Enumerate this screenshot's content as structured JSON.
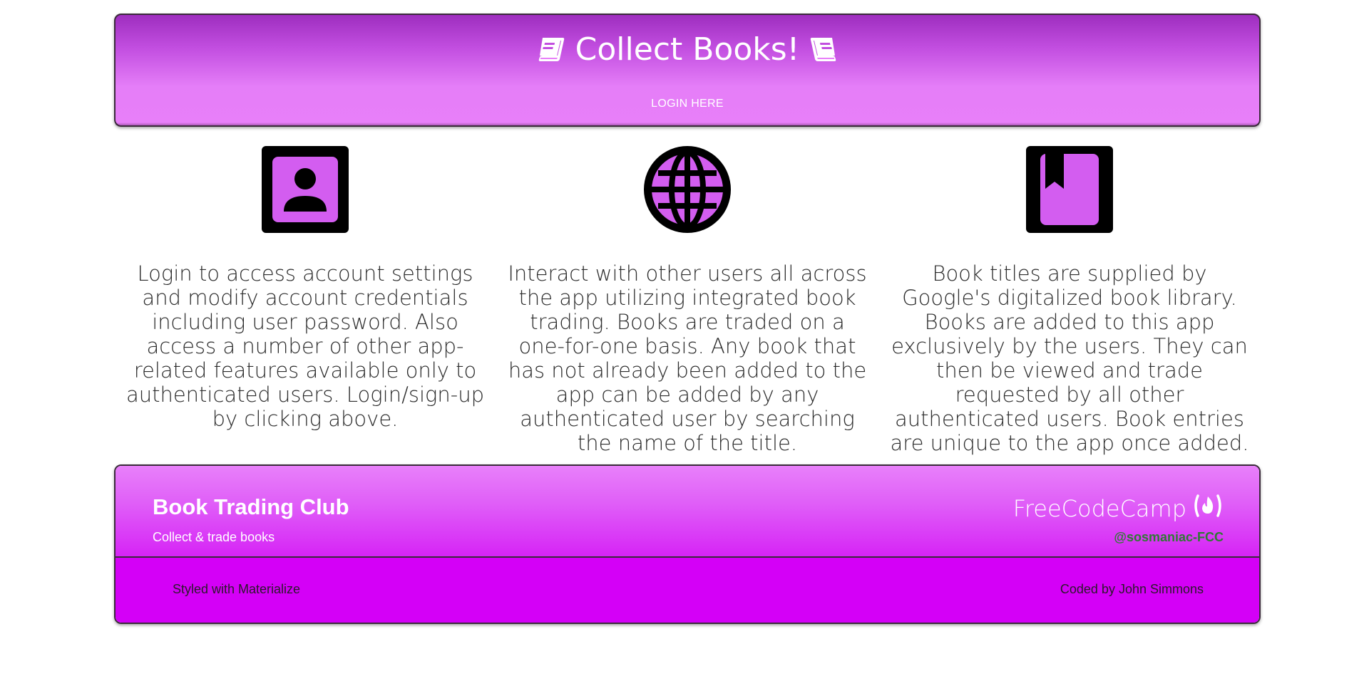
{
  "header": {
    "title": "Collect Books!",
    "login_label": "LOGIN HERE"
  },
  "features": [
    {
      "icon": "account-box-icon",
      "text": "Login to access account settings and modify account credentials including user password. Also access a number of other app-related features available only to authenticated users. Login/sign-up by clicking above."
    },
    {
      "icon": "globe-icon",
      "text": "Interact with other users all across the app utilizing integrated book trading. Books are traded on a one-for-one basis. Any book that has not already been added to the app can be added by any authenticated user by searching the name of the title."
    },
    {
      "icon": "book-bookmark-icon",
      "text": "Book titles are supplied by Google's digitalized book library. Books are added to this app exclusively by the users. They can then be viewed and trade requested by all other authenticated users. Book entries are unique to the app once added."
    }
  ],
  "footer": {
    "title": "Book Trading Club",
    "subtitle": "Collect & trade books",
    "fcc_label": "FreeCodeCamp",
    "handle": "@sosmaniac-FCC",
    "styled_with": "Styled with Materialize",
    "coded_by": "Coded by John Simmons"
  },
  "colors": {
    "accent": "#d400f7",
    "icon_fill": "#d35df0",
    "handle": "#2f7a34"
  }
}
